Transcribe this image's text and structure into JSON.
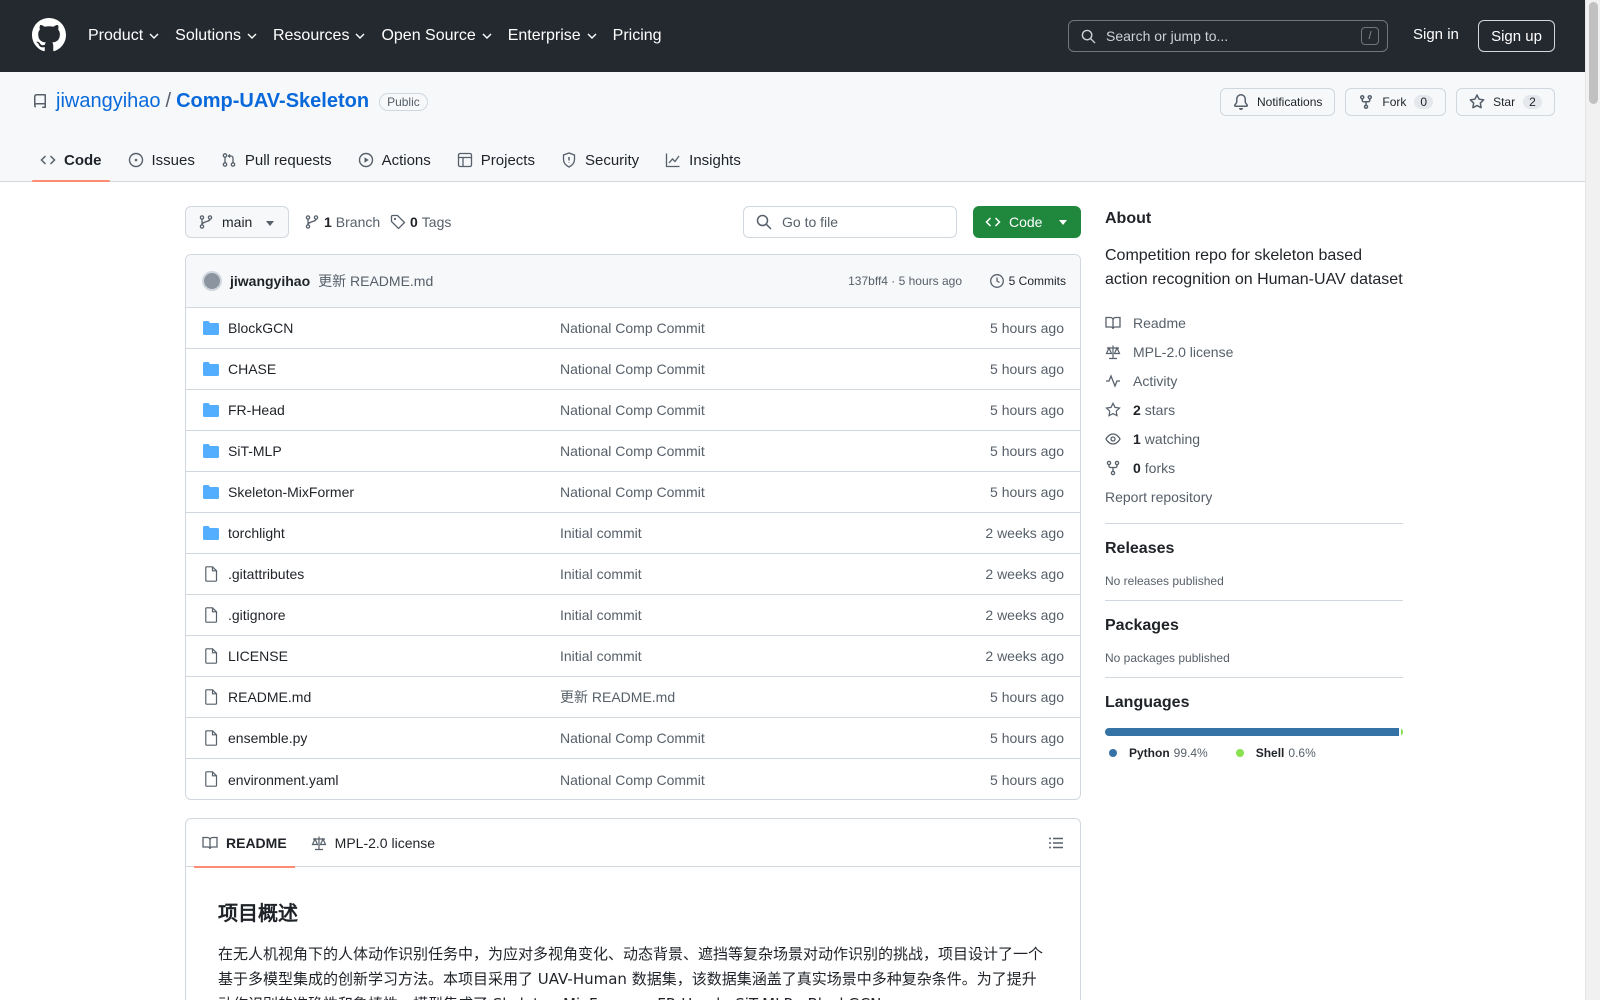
{
  "header": {
    "nav": [
      "Product",
      "Solutions",
      "Resources",
      "Open Source",
      "Enterprise",
      "Pricing"
    ],
    "search_placeholder": "Search or jump to...",
    "search_key": "/",
    "sign_in": "Sign in",
    "sign_up": "Sign up"
  },
  "repo": {
    "owner": "jiwangyihao",
    "separator": "/",
    "name": "Comp-UAV-Skeleton",
    "visibility": "Public",
    "notifications_label": "Notifications",
    "fork_label": "Fork",
    "fork_count": "0",
    "star_label": "Star",
    "star_count": "2"
  },
  "tabs": [
    "Code",
    "Issues",
    "Pull requests",
    "Actions",
    "Projects",
    "Security",
    "Insights"
  ],
  "filenav": {
    "branch": "main",
    "branch_count": "1",
    "branch_label": "Branch",
    "tag_count": "0",
    "tag_label": "Tags",
    "goto_placeholder": "Go to file",
    "code_label": "Code"
  },
  "latest_commit": {
    "author": "jiwangyihao",
    "message": "更新 README.md",
    "meta": "137bff4 · 5 hours ago",
    "commits": "5 Commits"
  },
  "files": [
    {
      "name": "BlockGCN",
      "type": "dir",
      "message": "National Comp Commit",
      "time": "5 hours ago"
    },
    {
      "name": "CHASE",
      "type": "dir",
      "message": "National Comp Commit",
      "time": "5 hours ago"
    },
    {
      "name": "FR-Head",
      "type": "dir",
      "message": "National Comp Commit",
      "time": "5 hours ago"
    },
    {
      "name": "SiT-MLP",
      "type": "dir",
      "message": "National Comp Commit",
      "time": "5 hours ago"
    },
    {
      "name": "Skeleton-MixFormer",
      "type": "dir",
      "message": "National Comp Commit",
      "time": "5 hours ago"
    },
    {
      "name": "torchlight",
      "type": "dir",
      "message": "Initial commit",
      "time": "2 weeks ago"
    },
    {
      "name": ".gitattributes",
      "type": "file",
      "message": "Initial commit",
      "time": "2 weeks ago"
    },
    {
      "name": ".gitignore",
      "type": "file",
      "message": "Initial commit",
      "time": "2 weeks ago"
    },
    {
      "name": "LICENSE",
      "type": "file",
      "message": "Initial commit",
      "time": "2 weeks ago"
    },
    {
      "name": "README.md",
      "type": "file",
      "message": "更新 README.md",
      "time": "5 hours ago"
    },
    {
      "name": "ensemble.py",
      "type": "file",
      "message": "National Comp Commit",
      "time": "5 hours ago"
    },
    {
      "name": "environment.yaml",
      "type": "file",
      "message": "National Comp Commit",
      "time": "5 hours ago"
    }
  ],
  "readme": {
    "tab_readme": "README",
    "tab_license": "MPL-2.0 license",
    "heading": "项目概述",
    "paragraph": "在无人机视角下的人体动作识别任务中，为应对多视角变化、动态背景、遮挡等复杂场景对动作识别的挑战，项目设计了一个基于多模型集成的创新学习方法。本项目采用了 UAV-Human 数据集，该数据集涵盖了真实场景中多种复杂条件。为了提升动作识别的准确性和鲁棒性，模型集成了 Skeleton-MixFormer、FR-Head、SiT-MLP、BlockGCN"
  },
  "about": {
    "title": "About",
    "description": "Competition repo for skeleton based action recognition on Human-UAV dataset",
    "readme": "Readme",
    "license": "MPL-2.0 license",
    "activity": "Activity",
    "stars_count": "2",
    "stars_label": "stars",
    "watching_count": "1",
    "watching_label": "watching",
    "forks_count": "0",
    "forks_label": "forks",
    "report": "Report repository"
  },
  "releases": {
    "title": "Releases",
    "text": "No releases published"
  },
  "packages": {
    "title": "Packages",
    "text": "No packages published"
  },
  "languages": {
    "title": "Languages",
    "items": [
      {
        "name": "Python",
        "percent": "99.4%",
        "value": 99.4,
        "color": "#3572A5"
      },
      {
        "name": "Shell",
        "percent": "0.6%",
        "value": 0.6,
        "color": "#89e051"
      }
    ]
  },
  "colors": {
    "accent": "#0969da",
    "primary_button": "#1f883d",
    "tab_underline": "#fd8c73",
    "folder": "#54aeff"
  }
}
